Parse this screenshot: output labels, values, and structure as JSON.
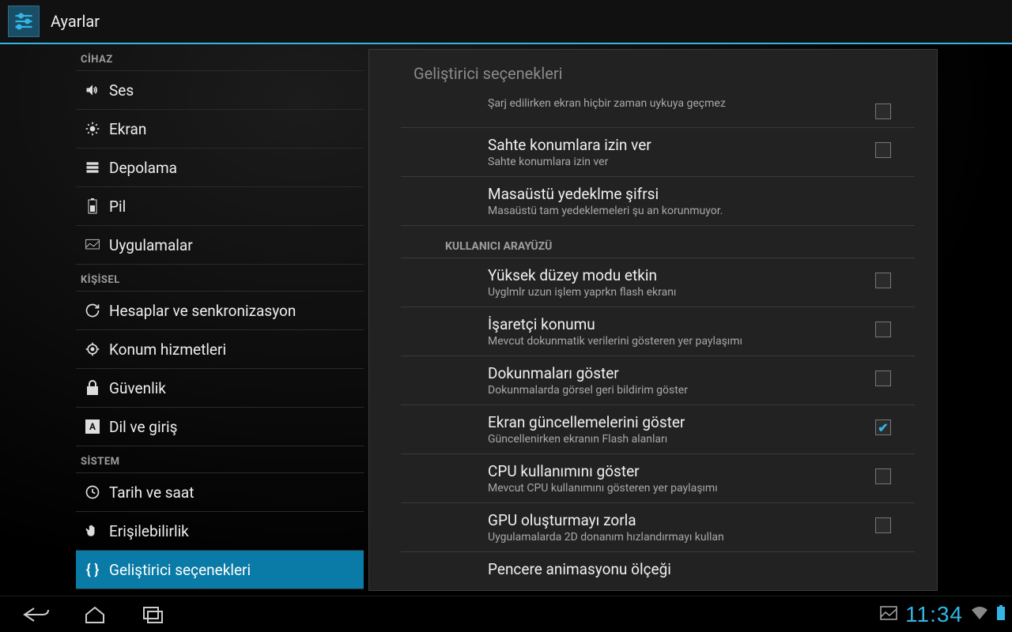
{
  "app": {
    "title": "Ayarlar"
  },
  "sidebar": {
    "sections": [
      {
        "header": "CİHAZ",
        "items": [
          {
            "key": "sound",
            "label": "Ses"
          },
          {
            "key": "display",
            "label": "Ekran"
          },
          {
            "key": "storage",
            "label": "Depolama"
          },
          {
            "key": "battery",
            "label": "Pil"
          },
          {
            "key": "apps",
            "label": "Uygulamalar"
          }
        ]
      },
      {
        "header": "KİŞİSEL",
        "items": [
          {
            "key": "accounts",
            "label": "Hesaplar ve senkronizasyon"
          },
          {
            "key": "location",
            "label": "Konum hizmetleri"
          },
          {
            "key": "security",
            "label": "Güvenlik"
          },
          {
            "key": "language",
            "label": "Dil ve giriş"
          }
        ]
      },
      {
        "header": "SİSTEM",
        "items": [
          {
            "key": "datetime",
            "label": "Tarih ve saat"
          },
          {
            "key": "accessibility",
            "label": "Erişilebilirlik"
          },
          {
            "key": "developer",
            "label": "Geliştirici seçenekleri",
            "selected": true
          }
        ]
      }
    ]
  },
  "main": {
    "title": "Geliştirici seçenekleri",
    "partial": {
      "subtitle": "Şarj edilirken ekran hiçbir zaman uykuya geçmez"
    },
    "items1": [
      {
        "title": "Sahte konumlara izin ver",
        "subtitle": "Sahte konumlara izin ver",
        "checkbox": true,
        "checked": false
      },
      {
        "title": "Masaüstü yedeklme şifrsi",
        "subtitle": "Masaüstü tam yedeklemeleri şu an korunmuyor.",
        "checkbox": false
      }
    ],
    "section2": "KULLANICI ARAYÜZÜ",
    "items2": [
      {
        "title": "Yüksek düzey modu etkin",
        "subtitle": "Uyglmlr uzun işlem yaprkn flash ekranı",
        "checkbox": true,
        "checked": false
      },
      {
        "title": "İşaretçi konumu",
        "subtitle": "Mevcut dokunmatik verilerini gösteren yer paylaşımı",
        "checkbox": true,
        "checked": false
      },
      {
        "title": "Dokunmaları göster",
        "subtitle": "Dokunmalarda görsel geri bildirim göster",
        "checkbox": true,
        "checked": false
      },
      {
        "title": "Ekran güncellemelerini göster",
        "subtitle": "Güncellenirken ekranın Flash alanları",
        "checkbox": true,
        "checked": true
      },
      {
        "title": "CPU kullanımını göster",
        "subtitle": "Mevcut CPU kullanımını gösteren yer paylaşımı",
        "checkbox": true,
        "checked": false
      },
      {
        "title": "GPU oluşturmayı zorla",
        "subtitle": "Uygulamalarda 2D donanım hızlandırmayı kullan",
        "checkbox": true,
        "checked": false
      },
      {
        "title": "Pencere animasyonu ölçeği",
        "subtitle": "",
        "checkbox": false
      }
    ]
  },
  "status": {
    "time": "11:34"
  }
}
